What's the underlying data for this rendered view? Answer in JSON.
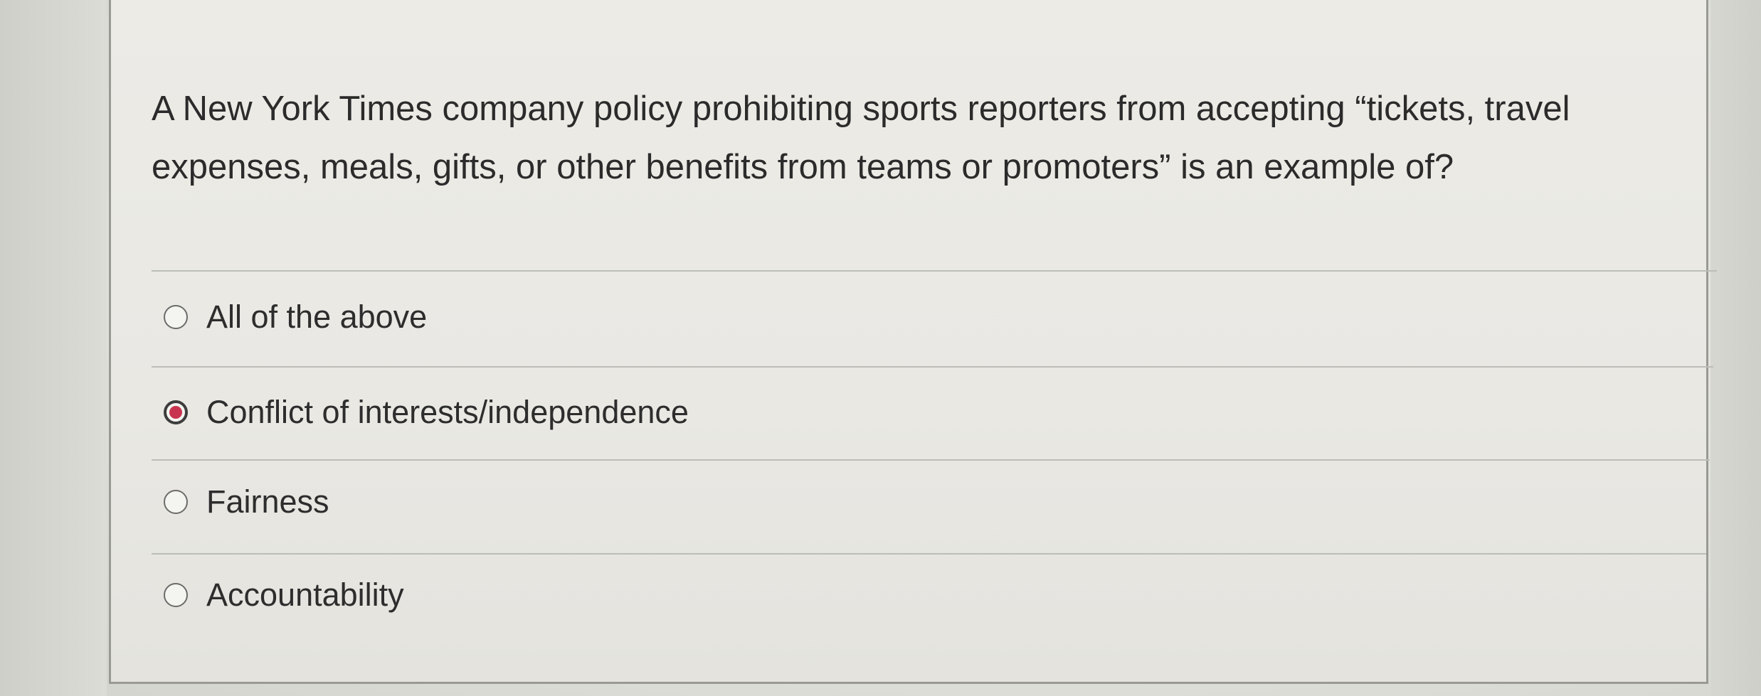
{
  "question": {
    "text": "A New York Times company policy prohibiting sports reporters from accepting “tickets, travel expenses, meals, gifts, or other benefits from teams or promoters” is an example of?"
  },
  "options": [
    {
      "label": "All of the above",
      "selected": false
    },
    {
      "label": "Conflict of interests/independence",
      "selected": true
    },
    {
      "label": "Fairness",
      "selected": false
    },
    {
      "label": "Accountability",
      "selected": false
    }
  ],
  "colors": {
    "selected_radio": "#c8344f",
    "text": "#2b2b2b",
    "card_border": "#9a9a95"
  }
}
